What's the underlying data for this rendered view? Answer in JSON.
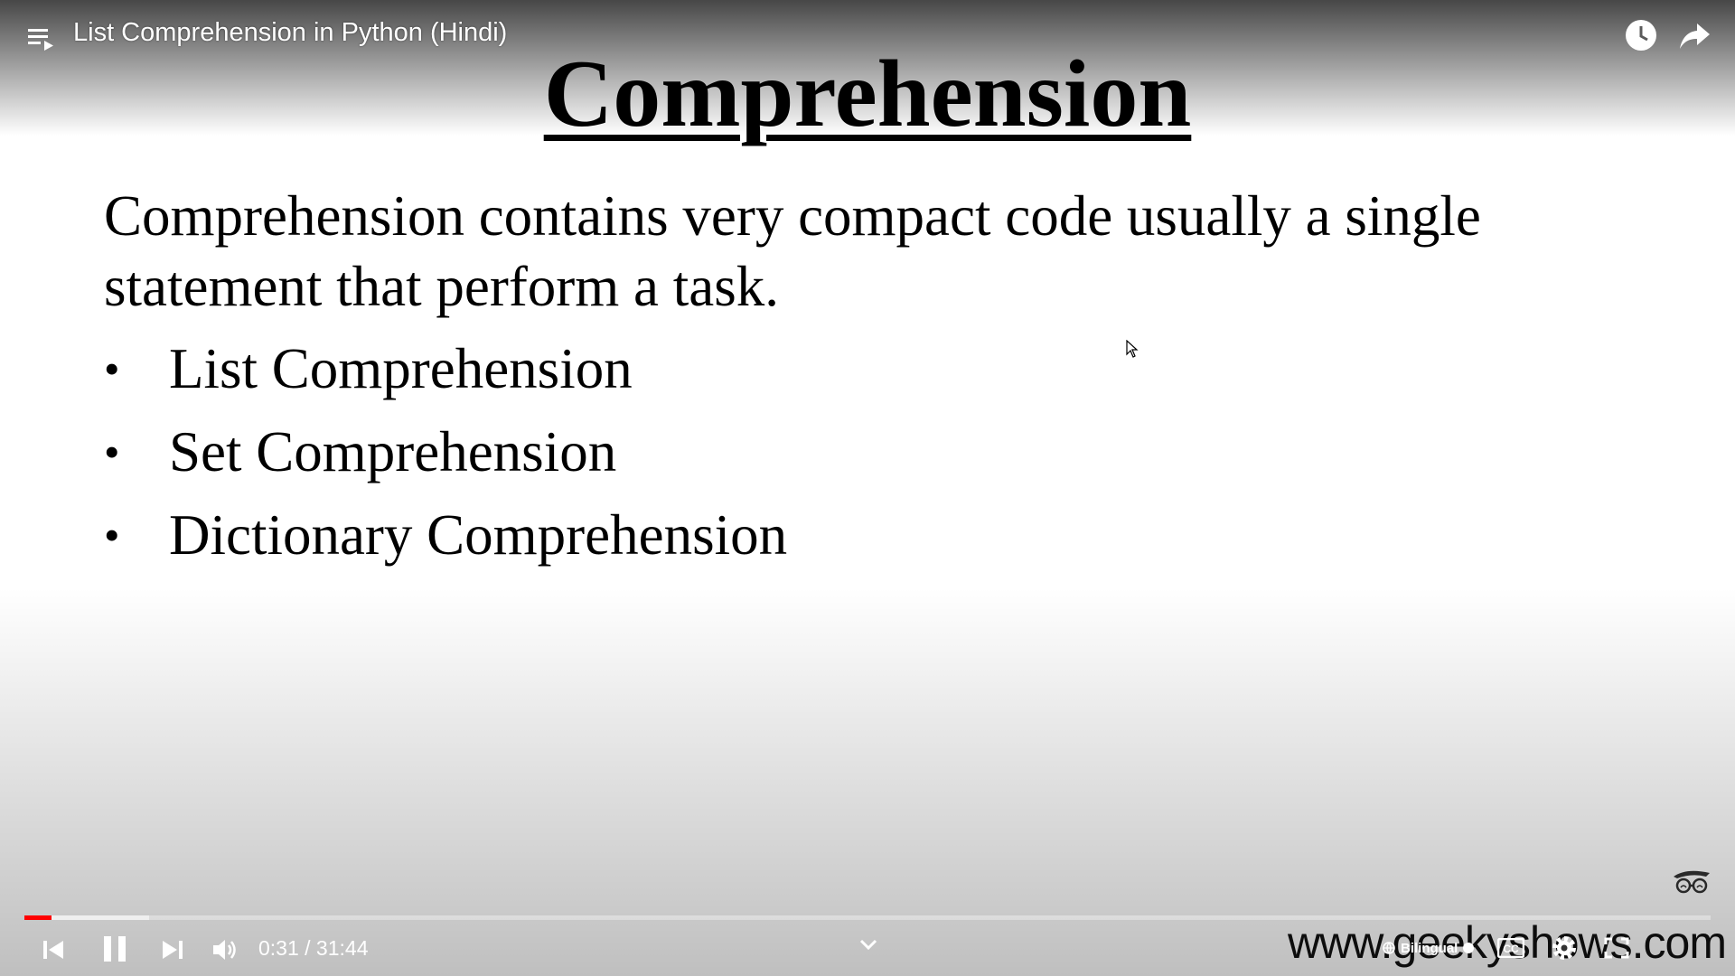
{
  "video": {
    "title": "List Comprehension in Python (Hindi)"
  },
  "slide": {
    "heading": "Comprehension",
    "intro": "Comprehension contains very compact code usually a single statement that perform a task.",
    "bullets": [
      "List Comprehension",
      "Set Comprehension",
      "Dictionary Comprehension"
    ],
    "watermark": "www.geekyshows.com"
  },
  "player": {
    "time_display": "0:31 / 31:44",
    "current_time": "0:31",
    "duration": "31:44",
    "played_fraction": 0.016,
    "loaded_fraction": 0.074,
    "subtitle_label": "Bilingual",
    "played_color": "#ff0000"
  },
  "icons": {
    "playlist": "playlist-icon",
    "watch_later": "clock-icon",
    "share": "share-arrow-icon",
    "previous": "skip-previous-icon",
    "pause": "pause-icon",
    "next": "skip-next-icon",
    "volume": "volume-icon",
    "chevron": "chevron-down-icon",
    "subtitles": "subtitles-icon",
    "settings": "gear-icon",
    "fullscreen": "fullscreen-icon"
  }
}
